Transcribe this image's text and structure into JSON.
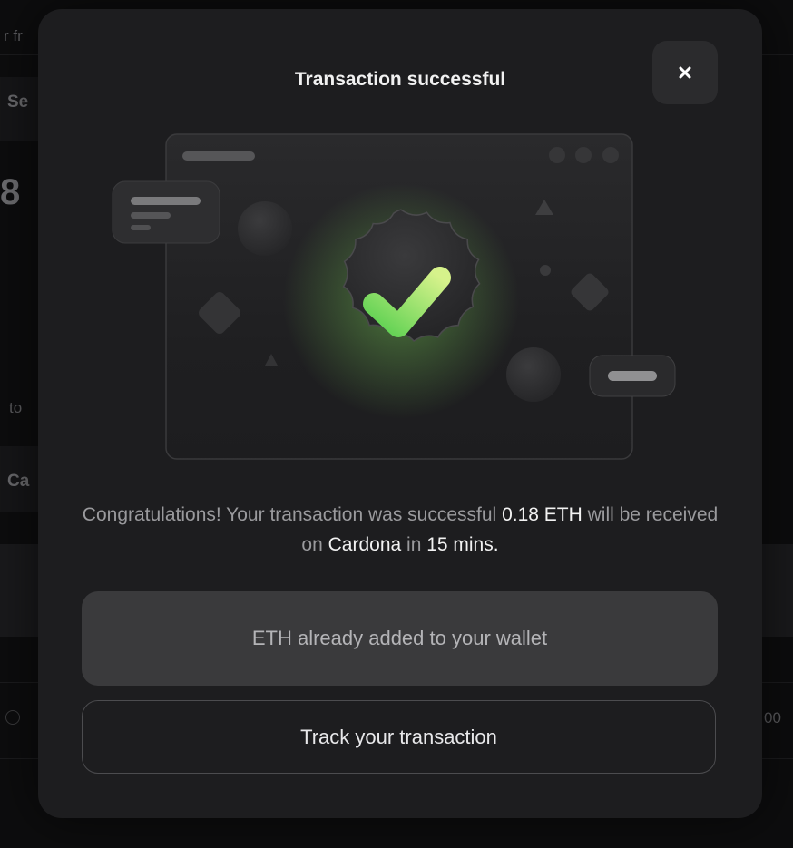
{
  "background": {
    "fragments": {
      "from": "r fr",
      "select": "Se",
      "amount_digit": "8",
      "to": "to",
      "network": "Ca",
      "row_value": "00"
    }
  },
  "modal": {
    "title": "Transaction successful",
    "close_icon": "close-icon",
    "message": {
      "text_1": "Congratulations! Your transaction was successful ",
      "amount": "0.18 ETH",
      "text_2": " will be received on ",
      "network": "Cardona",
      "text_3": " in ",
      "time": "15 mins."
    },
    "added_button_label": "ETH already added to your wallet",
    "track_button_label": "Track your transaction"
  },
  "colors": {
    "modal_bg": "#1d1d1f",
    "accent_green": "#7fdc5a",
    "button_bg": "#3a3a3c"
  }
}
